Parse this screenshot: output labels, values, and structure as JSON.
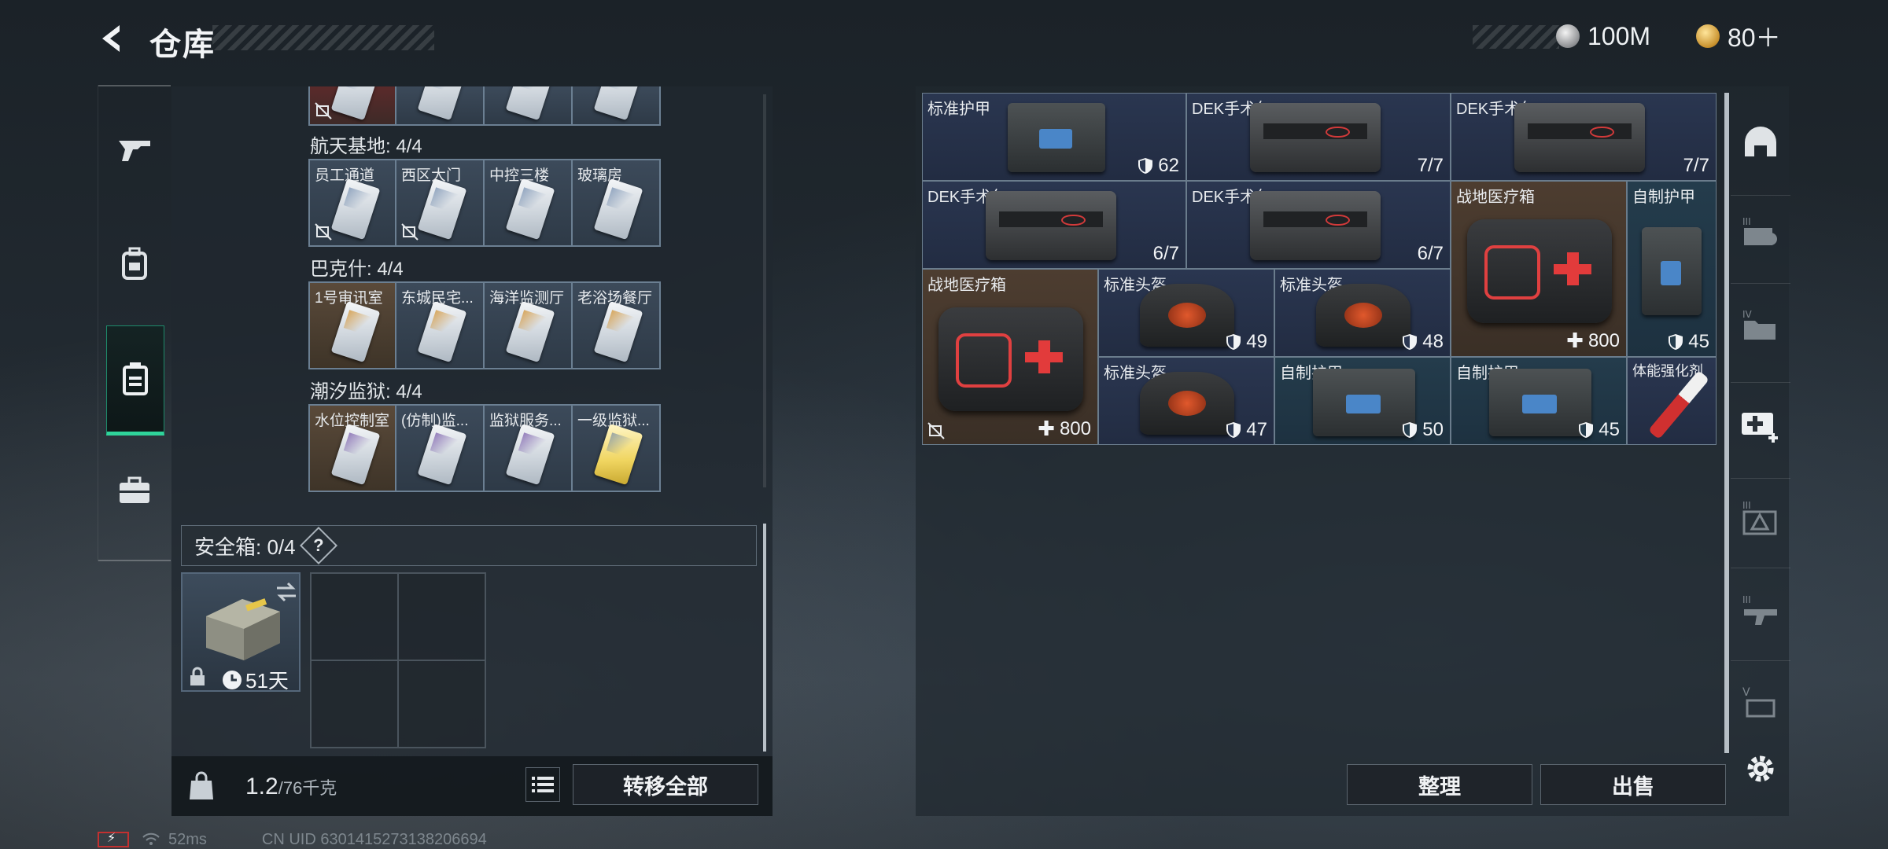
{
  "header": {
    "title": "仓库",
    "currency": [
      {
        "name": "silver-coin",
        "value": "100M"
      },
      {
        "name": "gold-coin",
        "value": "80＋"
      }
    ]
  },
  "left_nav": {
    "items": [
      {
        "icon": "gun-icon"
      },
      {
        "icon": "backpack-icon"
      },
      {
        "icon": "keycard-case-icon",
        "active": true
      },
      {
        "icon": "briefcase-icon"
      }
    ]
  },
  "key_regions": [
    {
      "title": "航天基地: 4/4",
      "keys": [
        {
          "label": "员工通道",
          "no_bind": true
        },
        {
          "label": "西区大门",
          "no_bind": true
        },
        {
          "label": "中控三楼"
        },
        {
          "label": "玻璃房"
        }
      ]
    },
    {
      "title": "巴克什: 4/4",
      "keys": [
        {
          "label": "1号审讯室"
        },
        {
          "label": "东城民宅..."
        },
        {
          "label": "海洋监测厅"
        },
        {
          "label": "老浴场餐厅"
        }
      ]
    },
    {
      "title": "潮汐监狱: 4/4",
      "keys": [
        {
          "label": "水位控制室"
        },
        {
          "label": "(仿制)监..."
        },
        {
          "label": "监狱服务..."
        },
        {
          "label": "一级监狱..."
        }
      ]
    }
  ],
  "safe_box": {
    "label": "安全箱: 0/4",
    "help": "?",
    "remaining": "51天"
  },
  "footer_left": {
    "weight": "1.2",
    "weight_max": "/76千克",
    "transfer_all": "转移全部"
  },
  "stash_items": [
    {
      "name": "标准护甲",
      "value": "62",
      "kind": "shield"
    },
    {
      "name": "DEK手术包",
      "value": "7/7",
      "kind": "count"
    },
    {
      "name": "DEK手术包",
      "value": "7/7",
      "kind": "count"
    },
    {
      "name": "DEK手术包",
      "value": "6/7",
      "kind": "count"
    },
    {
      "name": "DEK手术包",
      "value": "6/7",
      "kind": "count"
    },
    {
      "name": "战地医疗箱",
      "value": "800",
      "kind": "heal"
    },
    {
      "name": "自制护甲",
      "value": "45",
      "kind": "shield"
    },
    {
      "name": "战地医疗箱",
      "value": "800",
      "kind": "heal"
    },
    {
      "name": "标准头盔",
      "value": "49",
      "kind": "shield"
    },
    {
      "name": "标准头盔",
      "value": "48",
      "kind": "shield"
    },
    {
      "name": "标准头盔",
      "value": "47",
      "kind": "shield"
    },
    {
      "name": "自制护甲",
      "value": "50",
      "kind": "shield"
    },
    {
      "name": "自制护甲",
      "value": "45",
      "kind": "shield"
    },
    {
      "name": "体能强化剂",
      "value": "",
      "kind": "none"
    }
  ],
  "footer_right": {
    "sort": "整理",
    "sell": "出售"
  },
  "right_nav": {
    "items": [
      {
        "icon": "helmet-category-icon"
      },
      {
        "icon": "armor-tier-3-icon"
      },
      {
        "icon": "folder-tier-4-icon"
      },
      {
        "icon": "add-medkit-icon"
      },
      {
        "icon": "triangle-tier-3-icon"
      },
      {
        "icon": "weapon-tier-3-icon"
      },
      {
        "icon": "tier-5-icon"
      },
      {
        "icon": "settings-icon"
      }
    ]
  },
  "status_bar": {
    "ping": "52ms",
    "uid": "CN UID 6301415273138206694"
  }
}
